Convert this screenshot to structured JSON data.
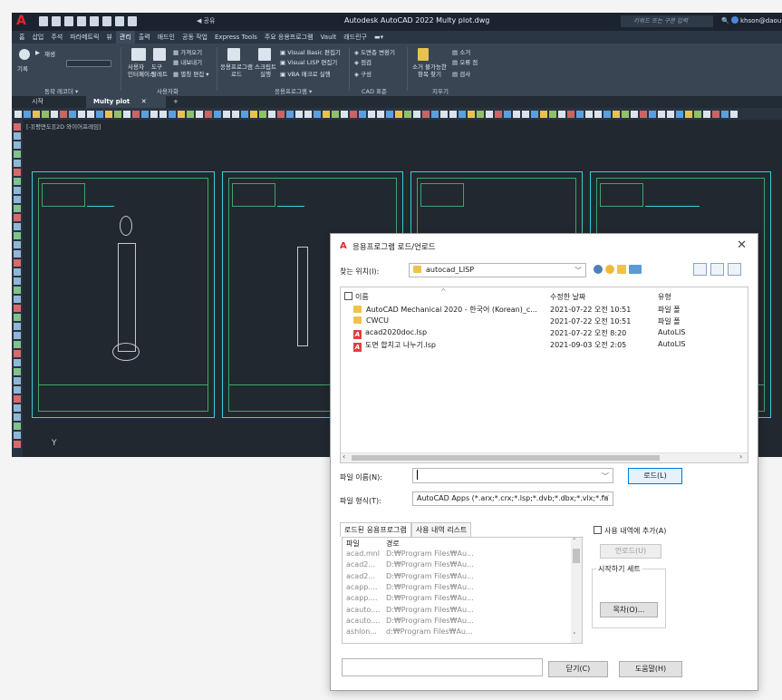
{
  "cad": {
    "title": "Autodesk AutoCAD 2022   Multy plot.dwg",
    "share_label": "공유",
    "search_placeholder": "키워드 또는 구문 입력",
    "user": "khson@daou...",
    "menu": [
      "홈",
      "삽입",
      "주석",
      "파라메트릭",
      "뷰",
      "관리",
      "출력",
      "애드인",
      "공동 작업",
      "Express Tools",
      "주요 응용프로그램",
      "Vault",
      "래드린구"
    ],
    "active_menu_index": 5,
    "ribbon": {
      "record": "기록",
      "record_sub": "재생",
      "action_panel": "동작 레코더 ▾",
      "cui_label": "사용자\n인터페이스",
      "tool_palette": "도구\n팔레트",
      "import": "가져오기",
      "export": "내보내기",
      "edit_alias": "별칭 편집 ▾",
      "custom_panel": "사용자화",
      "load_app": "응용프로그램\n로드",
      "run_script": "스크립트\n실행",
      "vb_editor": "Visual Basic 편집기",
      "vlisp_editor": "Visual LISP 편집기",
      "vba_macro": "VBA 매크로 실행",
      "app_panel": "응용프로그램 ▾",
      "std_convert": "도면층 변환기",
      "check": "점검",
      "config": "구성",
      "cad_std_panel": "CAD 표준",
      "purge_hidden": "소거 불가능한\n항목 찾기",
      "purge": "소거",
      "audit": "오류 점",
      "inspect": "검사",
      "cleanup_panel": "지우기"
    },
    "tabs": [
      "시작",
      "Multy plot"
    ],
    "view_label": "[-][평면도][2D 와이어프레임]",
    "ucs_label": "Y"
  },
  "dialog": {
    "title": "응용프로그램 로드/언로드",
    "look_in_label": "찾는 위치(I):",
    "look_in_value": "autocad_LISP",
    "columns": {
      "name": "이름",
      "date": "수정한 날짜",
      "type": "유형"
    },
    "files": [
      {
        "name": "AutoCAD Mechanical 2020 - 한국어 (Korean)_c...",
        "date": "2021-07-22 오전 10:51",
        "type": "파일 폴",
        "kind": "folder"
      },
      {
        "name": "CWCU",
        "date": "2021-07-22 오전 10:51",
        "type": "파일 폴",
        "kind": "folder"
      },
      {
        "name": "acad2020doc.lsp",
        "date": "2021-07-22 오전 8:20",
        "type": "AutoLIS",
        "kind": "lsp"
      },
      {
        "name": "도면 합치고 나누기.lsp",
        "date": "2021-09-03 오전 2:05",
        "type": "AutoLIS",
        "kind": "lsp"
      }
    ],
    "file_name_label": "파일 이름(N):",
    "file_name_value": "",
    "file_type_label": "파일 형식(T):",
    "file_type_value": "AutoCAD Apps (*.arx;*.crx;*.lsp;*.dvb;*.dbx;*.vlx;*.fa",
    "load_button": "로드(L)",
    "loaded_tab": "로드된 응용프로그램",
    "history_tab": "사용 내역 리스트",
    "add_history_label": "사용 내역에 추가(A)",
    "loaded_columns": {
      "file": "파일",
      "path": "경로"
    },
    "loaded": [
      {
        "file": "acad.mnl",
        "path": "D:₩Program Files₩Au..."
      },
      {
        "file": "acad2...",
        "path": "D:₩Program Files₩Au..."
      },
      {
        "file": "acad2...",
        "path": "D:₩Program Files₩Au..."
      },
      {
        "file": "acapp....",
        "path": "D:₩Program Files₩Au..."
      },
      {
        "file": "acapp....",
        "path": "D:₩Program Files₩Au..."
      },
      {
        "file": "acauto....",
        "path": "D:₩Program Files₩Au..."
      },
      {
        "file": "acauto....",
        "path": "D:₩Program Files₩Au..."
      },
      {
        "file": "ashlon...",
        "path": "d:₩Program Files₩Au..."
      }
    ],
    "unload_button": "언로드(U)",
    "startup_suite_label": "시작하기 세트",
    "contents_button": "목차(O)...",
    "close_button": "닫기(C)",
    "help_button": "도움말(H)"
  }
}
